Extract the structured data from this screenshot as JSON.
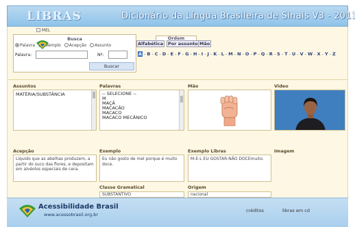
{
  "header": {
    "logo": "LIBRAS",
    "title": "Dicionário da Língua Brasileira de Sinais V3 - 2011"
  },
  "busca": {
    "title": "Busca",
    "options": [
      "Palavra",
      "Exemplo",
      "Acepção",
      "Assunto"
    ],
    "selected": "Palavra",
    "palavra_label": "Palavra:",
    "palavra_value": "",
    "numero_label": "Nº:",
    "numero_value": "",
    "button": "Buscar"
  },
  "ordem": {
    "title": "Ordem",
    "alfabetica": "Alfabética",
    "por_assunto": "Por assunto",
    "mao": "Mão"
  },
  "alphabet": {
    "letters": [
      "A",
      "B",
      "C",
      "D",
      "E",
      "F",
      "G",
      "H",
      "I",
      "J",
      "K",
      "L",
      "M",
      "N",
      "O",
      "P",
      "Q",
      "R",
      "S",
      "T",
      "U",
      "V",
      "W",
      "X",
      "Y",
      "Z"
    ],
    "selected": "A"
  },
  "columns": {
    "assuntos": "Assuntos",
    "palavras": "Palavras",
    "mao": "Mão",
    "video": "Video",
    "acepcao": "Acepção",
    "exemplo": "Exemplo",
    "exemplo_libras": "Exemplo Libras",
    "imagem": "Imagem",
    "classe": "Classe Gramatical",
    "origem": "Origem"
  },
  "assuntos": {
    "selected": "MATÉRIA/SUBSTÂNCIA"
  },
  "palavras": {
    "items": [
      "-- SELECIONE --",
      "M",
      "MAÇÃ",
      "MACACÃO",
      "MACACO",
      "MACACO MECÂNICO"
    ]
  },
  "details": {
    "acepcao": "Líquido que as abelhas produzem, a partir do suco das flores, e depositam em alvéolos especiais de cera.",
    "exemplo": "Eu não gosto de mel porque é muito doce.",
    "exemplo_libras": "M-E-L EU GOSTAR-NÃO DOCEmuito.",
    "imagem_alt": "MEL",
    "classe": "SUBSTANTIVO",
    "origem": "nacional"
  },
  "footer": {
    "brand": "Acessibilidade Brasil",
    "url": "www.acessobrasil.org.br",
    "creditos": "créditos",
    "libras_em_cd": "libras em cd"
  },
  "colors": {
    "header": "#8fc3ea",
    "body": "#fdf7e4",
    "footer": "#a9cfee",
    "accent": "#3a6fc4"
  }
}
